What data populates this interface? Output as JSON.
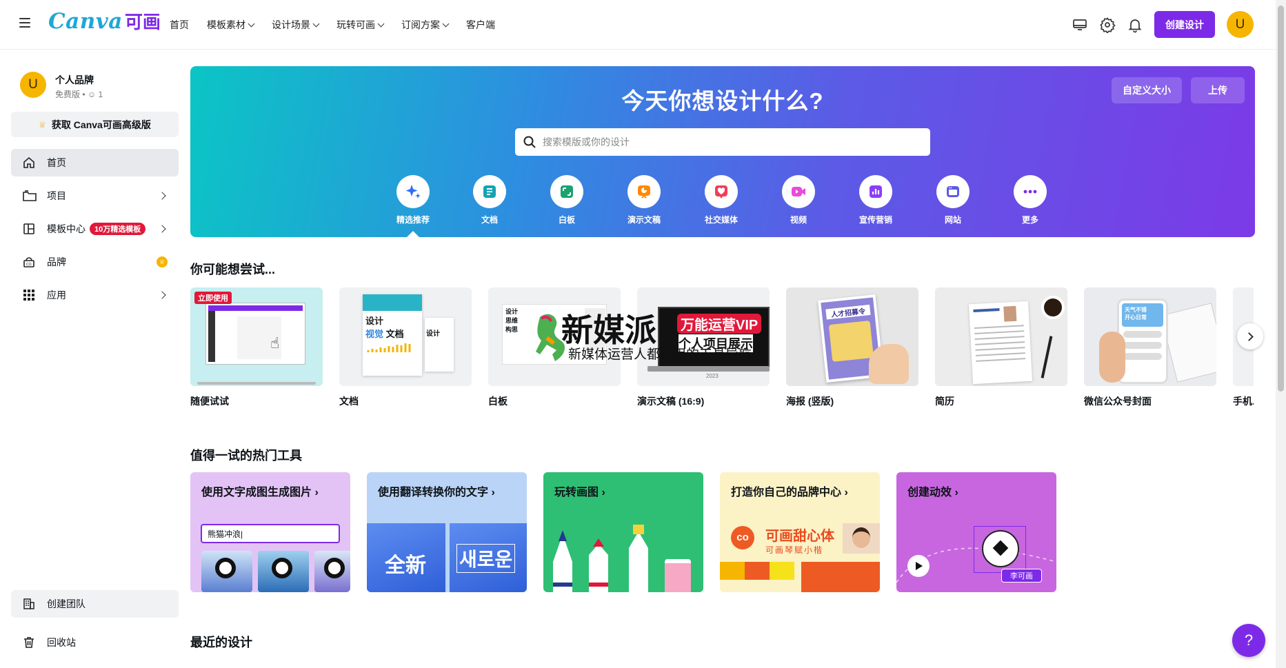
{
  "header": {
    "menu_icon": "hamburger-icon",
    "logo_text": "Canva",
    "logo_cn": "可画",
    "nav": [
      {
        "label": "首页",
        "dropdown": false
      },
      {
        "label": "模板素材",
        "dropdown": true
      },
      {
        "label": "设计场景",
        "dropdown": true
      },
      {
        "label": "玩转可画",
        "dropdown": true
      },
      {
        "label": "订阅方案",
        "dropdown": true
      },
      {
        "label": "客户端",
        "dropdown": false
      }
    ],
    "icons": [
      "monitor-icon",
      "gear-icon",
      "bell-icon"
    ],
    "create_label": "创建设计",
    "avatar_initial": "U"
  },
  "sidebar": {
    "avatar_initial": "U",
    "brand_name": "个人品牌",
    "brand_plan": "免费版 • ",
    "brand_members": "1",
    "upgrade_label": "获取 Canva可画高级版",
    "items": [
      {
        "label": "首页",
        "icon": "home-icon"
      },
      {
        "label": "项目",
        "icon": "folder-icon"
      },
      {
        "label": "模板中心",
        "icon": "template-icon",
        "badge": "10万精选模板"
      },
      {
        "label": "品牌",
        "icon": "brand-icon"
      },
      {
        "label": "应用",
        "icon": "apps-grid-icon"
      }
    ],
    "create_team_label": "创建团队",
    "trash_label": "回收站"
  },
  "hero": {
    "title": "今天你想设计什么?",
    "custom_size_label": "自定义大小",
    "upload_label": "上传",
    "search_placeholder": "搜索模版或你的设计",
    "categories": [
      {
        "label": "精选推荐",
        "icon": "sparkle-icon",
        "color": "#2f6cf6"
      },
      {
        "label": "文档",
        "icon": "document-icon",
        "color": "#13a3b5"
      },
      {
        "label": "白板",
        "icon": "whiteboard-icon",
        "color": "#1aa36f"
      },
      {
        "label": "演示文稿",
        "icon": "presentation-icon",
        "color": "#ff8a00"
      },
      {
        "label": "社交媒体",
        "icon": "heart-icon",
        "color": "#f03e5a"
      },
      {
        "label": "视频",
        "icon": "video-icon",
        "color": "#e94bd8"
      },
      {
        "label": "宣传营销",
        "icon": "chart-icon",
        "color": "#8b3ff5"
      },
      {
        "label": "网站",
        "icon": "website-icon",
        "color": "#5b5be6"
      },
      {
        "label": "更多",
        "icon": "more-icon",
        "color": "#7d2ae8"
      }
    ]
  },
  "try_section": {
    "title": "你可能想尝试...",
    "items": [
      {
        "label": "随便试试",
        "badge": "立即使用"
      },
      {
        "label": "文档",
        "thumb_text": [
          "设计",
          "视觉",
          "文档"
        ]
      },
      {
        "label": "白板",
        "thumb_text": [
          "设计",
          "思维",
          "构思"
        ]
      },
      {
        "label": "演示文稿 (16:9)",
        "thumb_text": [
          "新媒派",
          "万能运营VIP",
          "个人项目展示",
          "新媒体运营人都在用的工具导航",
          "2023"
        ]
      },
      {
        "label": "海报 (竖版)",
        "thumb_text": [
          "人才招募令"
        ]
      },
      {
        "label": "简历"
      },
      {
        "label": "微信公众号封面",
        "thumb_text": [
          "天气不错",
          "开心日常"
        ]
      },
      {
        "label": "手机..."
      }
    ]
  },
  "tools_section": {
    "title": "值得一试的热门工具",
    "items": [
      {
        "label": "使用文字成图生成图片",
        "input_text": "熊猫冲浪",
        "bg": "#e3c3f5"
      },
      {
        "label": "使用翻译转换你的文字",
        "text_a": "全新",
        "text_b": "새로운",
        "bg": "#b9d4f7"
      },
      {
        "label": "玩转画图",
        "bg": "#2ebf74"
      },
      {
        "label": "打造你自己的品牌中心",
        "brand_text": "可画甜心体",
        "brand_sub": "可画琴赋小楷",
        "bg": "#fbf2c6"
      },
      {
        "label": "创建动效",
        "tag": "李可画",
        "bg": "#c866e0"
      }
    ]
  },
  "recent_section": {
    "title": "最近的设计"
  },
  "help_label": "?"
}
